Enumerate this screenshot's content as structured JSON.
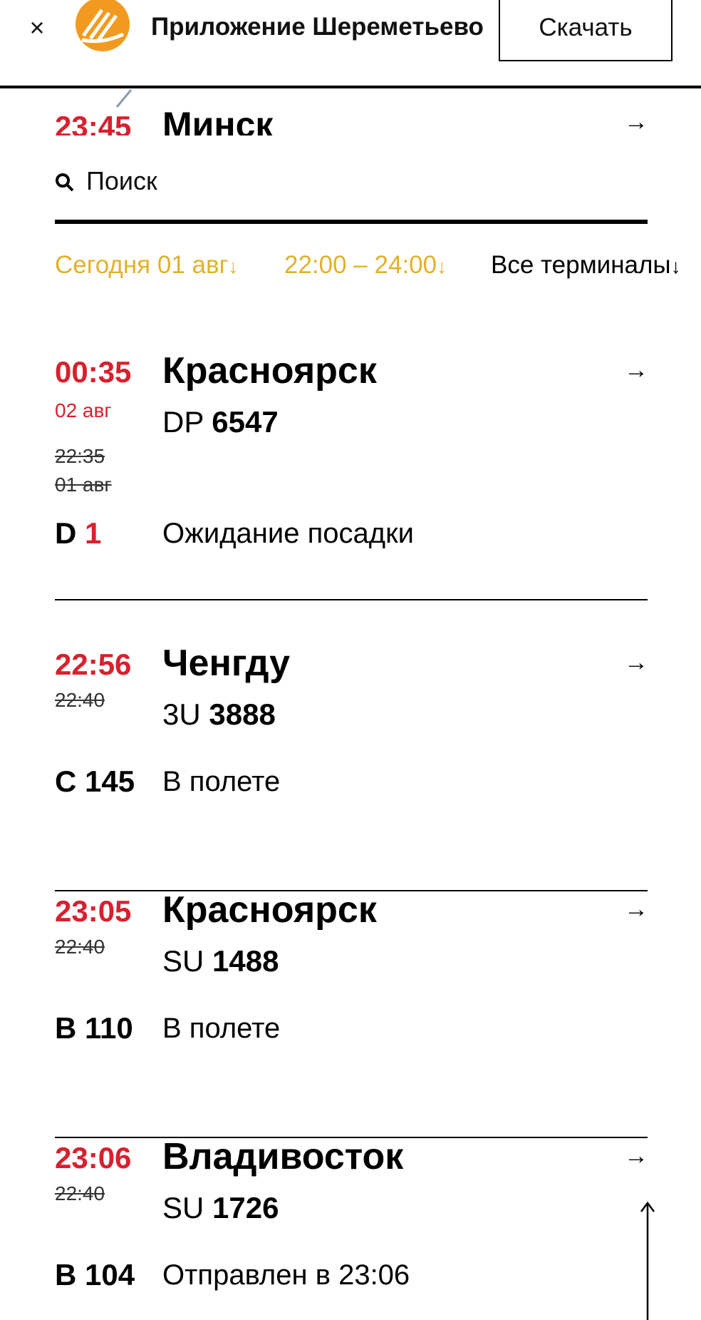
{
  "banner": {
    "close_glyph": "×",
    "app_title": "Приложение Шереметьево",
    "download_label": "Скачать",
    "logo_color": "#F29A1F"
  },
  "previous_flight": {
    "time": "23:45",
    "city": "Минск",
    "arrow": "→"
  },
  "search": {
    "placeholder": "Поиск",
    "icon": "search-icon"
  },
  "filters": {
    "date": "Сегодня 01 авг",
    "time_range": "22:00 – 24:00",
    "terminals": "Все терминалы",
    "down_arrow": "↓",
    "active_color": "#E2B12B"
  },
  "flights": [
    {
      "time": "00:35",
      "date": "02 авг",
      "old_time": "22:35",
      "old_date": "01 авг",
      "city": "Красноярск",
      "airline": "DP",
      "number": "6547",
      "gate_letter": "D",
      "gate_number": "1",
      "status": "Ожидание посадки",
      "arrow": "→"
    },
    {
      "time": "22:56",
      "old_time": "22:40",
      "city": "Ченгду",
      "airline": "3U",
      "number": "3888",
      "gate": "C 145",
      "status": "В полете",
      "arrow": "→"
    },
    {
      "time": "23:05",
      "old_time": "22:40",
      "city": "Красноярск",
      "airline": "SU",
      "number": "1488",
      "gate": "B 110",
      "status": "В полете",
      "arrow": "→"
    },
    {
      "time": "23:06",
      "old_time": "22:40",
      "city": "Владивосток",
      "airline": "SU",
      "number": "1726",
      "gate": "B 104",
      "status": "Отправлен в 23:06",
      "arrow": "→"
    }
  ],
  "accent_red": "#D8202E"
}
